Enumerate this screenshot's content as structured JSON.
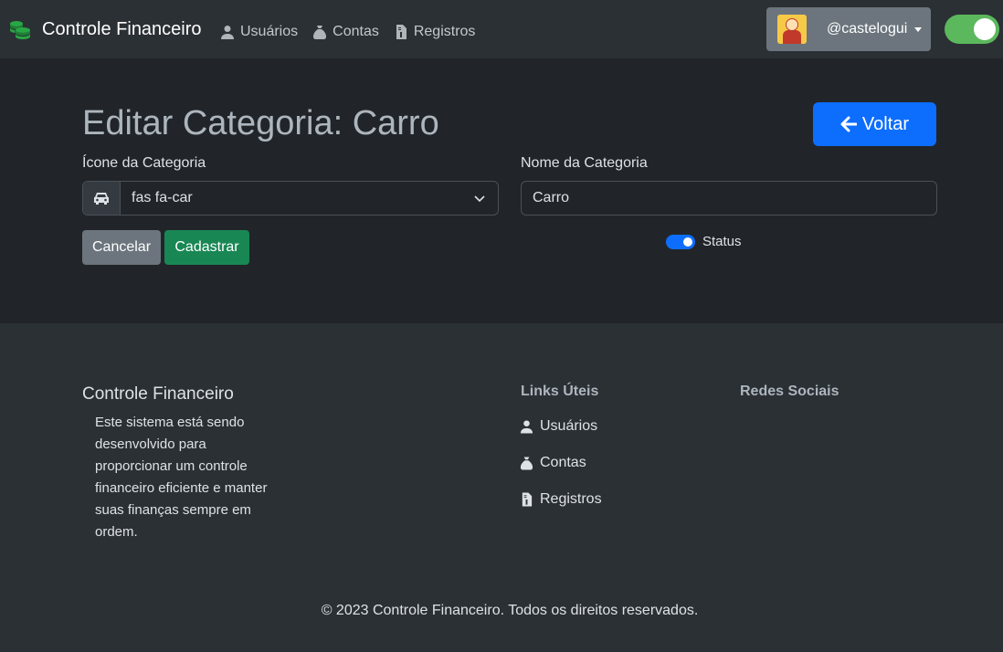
{
  "navbar": {
    "brand": "Controle Financeiro",
    "links": [
      "Usuários",
      "Contas",
      "Registros"
    ],
    "user": "@castelogui"
  },
  "form": {
    "title": "Editar Categoria: Carro",
    "back_label": "Voltar",
    "icon_label": "Ícone da Categoria",
    "icon_value": "fas fa-car",
    "name_label": "Nome da Categoria",
    "name_value": "Carro",
    "status_label": "Status",
    "status_on": true,
    "cancel_label": "Cancelar",
    "submit_label": "Cadastrar"
  },
  "footer": {
    "title": "Controle Financeiro",
    "description": "Este sistema está sendo desenvolvido para proporcionar um controle financeiro eficiente e manter suas finanças sempre em ordem.",
    "links_heading": "Links Úteis",
    "links": [
      "Usuários",
      "Contas",
      "Registros"
    ],
    "social_heading": "Redes Sociais",
    "copyright": "© 2023 Controle Financeiro. Todos os direitos reservados."
  },
  "colors": {
    "primary": "#0d6efd",
    "success": "#198754",
    "secondary": "#6c757d",
    "toggle": "#5cb85c"
  }
}
